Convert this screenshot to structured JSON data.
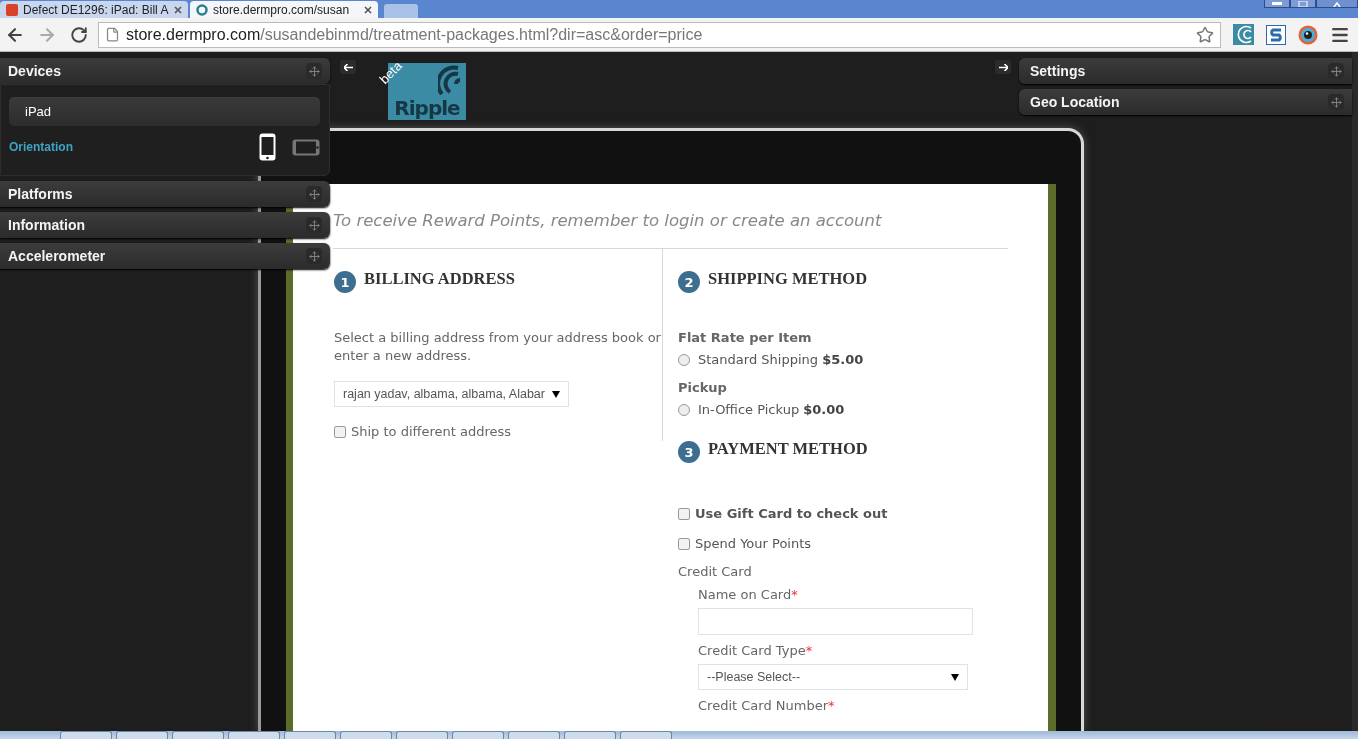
{
  "browser": {
    "tabs": [
      {
        "title": "Defect DE1296: iPad: Bill A",
        "selected": false
      },
      {
        "title": "store.dermpro.com/susan",
        "selected": true
      }
    ],
    "url": {
      "host": "store.dermpro.com",
      "path": "/susandebinmd/treatment-packages.html?dir=asc&order=price"
    }
  },
  "left_panels": [
    {
      "title": "Devices",
      "expanded": true,
      "device": "iPad",
      "orientation_label": "Orientation",
      "orientations": [
        {
          "kind": "portrait",
          "selected": true
        },
        {
          "kind": "landscape",
          "selected": false
        }
      ]
    },
    {
      "title": "Platforms",
      "expanded": false
    },
    {
      "title": "Information",
      "expanded": false
    },
    {
      "title": "Accelerometer",
      "expanded": false
    }
  ],
  "logo": {
    "text": "Ripple",
    "badge": "beta"
  },
  "right_panels": [
    {
      "title": "Settings"
    },
    {
      "title": "Geo Location"
    }
  ],
  "page": {
    "notice": "To receive Reward Points, remember to login or create an account",
    "billing": {
      "number": "1",
      "title": "BILLING ADDRESS",
      "instruction": "Select a billing address from your address book or enter a new address.",
      "address": "rajan yadav, albama, albama, Alabar",
      "ship_different": {
        "label": "Ship to different address",
        "checked": false
      }
    },
    "shipping": {
      "number": "2",
      "title": "SHIPPING METHOD",
      "groups": [
        {
          "name": "Flat Rate per Item",
          "options": [
            {
              "label": "Standard Shipping",
              "price": "$5.00",
              "selected": false
            }
          ]
        },
        {
          "name": "Pickup",
          "options": [
            {
              "label": "In-Office Pickup",
              "price": "$0.00",
              "selected": false
            }
          ]
        }
      ]
    },
    "payment": {
      "number": "3",
      "title": "PAYMENT METHOD",
      "options": [
        {
          "label": "Use Gift Card to check out",
          "kind": "strong",
          "checked": false
        },
        {
          "label": "Spend Your Points",
          "kind": "plain",
          "checked": false
        }
      ],
      "method": "Credit Card",
      "fields": [
        {
          "label": "Name on Card",
          "mark": "*",
          "kind": "text"
        },
        {
          "label": "Credit Card Type",
          "mark": "*",
          "kind": "select",
          "value": "--Please Select--"
        },
        {
          "label": "Credit Card Number",
          "mark": "*",
          "kind": "label"
        }
      ]
    }
  }
}
